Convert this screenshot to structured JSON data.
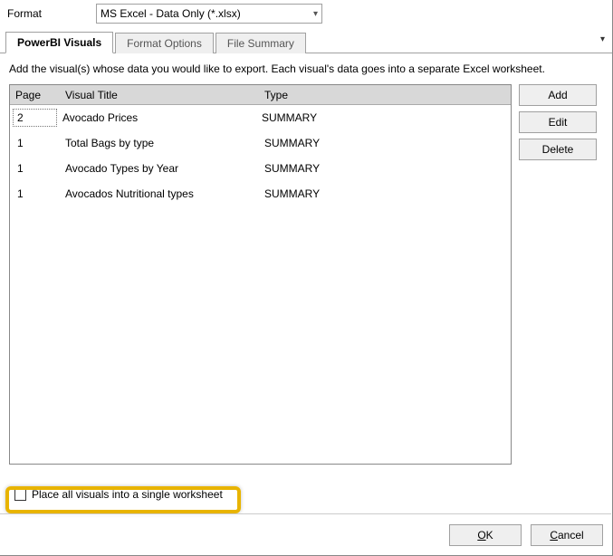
{
  "format": {
    "label": "Format",
    "value": "MS Excel - Data Only (*.xlsx)"
  },
  "tabs": {
    "t0": "PowerBI Visuals",
    "t1": "Format Options",
    "t2": "File Summary"
  },
  "instruction": "Add the visual(s) whose data you would like to export. Each visual's data goes into a separate Excel worksheet.",
  "columns": {
    "page": "Page",
    "title": "Visual Title",
    "type": "Type"
  },
  "rows": [
    {
      "page": "2",
      "title": "Avocado Prices",
      "type": "SUMMARY"
    },
    {
      "page": "1",
      "title": "Total Bags by type",
      "type": "SUMMARY"
    },
    {
      "page": "1",
      "title": "Avocado Types by Year",
      "type": "SUMMARY"
    },
    {
      "page": "1",
      "title": "Avocados Nutritional types",
      "type": "SUMMARY"
    }
  ],
  "buttons": {
    "add": "Add",
    "edit": "Edit",
    "delete": "Delete"
  },
  "checkbox_label": "Place all visuals into a single worksheet",
  "footer": {
    "ok_pre": "",
    "ok_u": "O",
    "ok_post": "K",
    "cancel_pre": "",
    "cancel_u": "C",
    "cancel_post": "ancel"
  }
}
